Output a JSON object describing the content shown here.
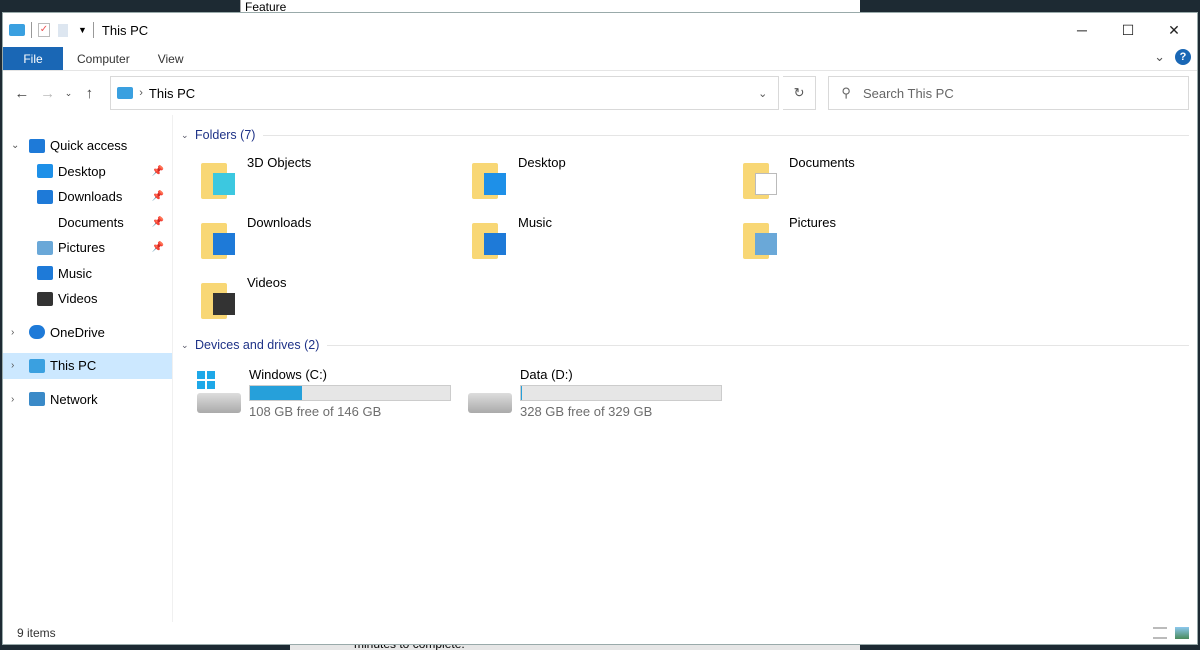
{
  "background": {
    "window_text_top": "Feature",
    "window_text_bottom": "minutes to complete."
  },
  "window": {
    "title": "This PC"
  },
  "ribbon": {
    "tabs": [
      "File",
      "Computer",
      "View"
    ]
  },
  "address": {
    "path": "This PC",
    "search_placeholder": "Search This PC"
  },
  "sidebar": {
    "items": [
      {
        "label": "Quick access",
        "icon": "star-icon",
        "level": 0,
        "chev": "expanded"
      },
      {
        "label": "Desktop",
        "icon": "desktop-icon",
        "level": 1,
        "pinned": true
      },
      {
        "label": "Downloads",
        "icon": "download-icon",
        "level": 1,
        "pinned": true
      },
      {
        "label": "Documents",
        "icon": "document-icon",
        "level": 1,
        "pinned": true
      },
      {
        "label": "Pictures",
        "icon": "picture-icon",
        "level": 1,
        "pinned": true
      },
      {
        "label": "Music",
        "icon": "music-icon",
        "level": 1
      },
      {
        "label": "Videos",
        "icon": "video-icon",
        "level": 1
      },
      {
        "label": "OneDrive",
        "icon": "cloud-icon",
        "level": 0,
        "chev": "collapsed"
      },
      {
        "label": "This PC",
        "icon": "computer-icon",
        "level": 0,
        "chev": "collapsed",
        "selected": true
      },
      {
        "label": "Network",
        "icon": "network-icon",
        "level": 0,
        "chev": "collapsed"
      }
    ]
  },
  "main": {
    "folders_header": "Folders (7)",
    "folders": [
      {
        "label": "3D Objects",
        "icon": "cube-icon"
      },
      {
        "label": "Desktop",
        "icon": "desktop-icon"
      },
      {
        "label": "Documents",
        "icon": "document-icon"
      },
      {
        "label": "Downloads",
        "icon": "download-icon"
      },
      {
        "label": "Music",
        "icon": "music-icon"
      },
      {
        "label": "Pictures",
        "icon": "picture-icon"
      },
      {
        "label": "Videos",
        "icon": "video-icon"
      }
    ],
    "drives_header": "Devices and drives (2)",
    "drives": [
      {
        "label": "Windows (C:)",
        "free": "108 GB free of 146 GB",
        "used_fraction": 0.26,
        "windows_logo": true
      },
      {
        "label": "Data (D:)",
        "free": "328 GB free of 329 GB",
        "used_fraction": 0.003
      }
    ]
  },
  "status": {
    "items": "9 items"
  },
  "colors": {
    "accent": "#1a67b5",
    "selection": "#cce8ff",
    "drive_bar": "#26a0da",
    "group_header": "#1e3287",
    "folder": "#f8d775"
  }
}
